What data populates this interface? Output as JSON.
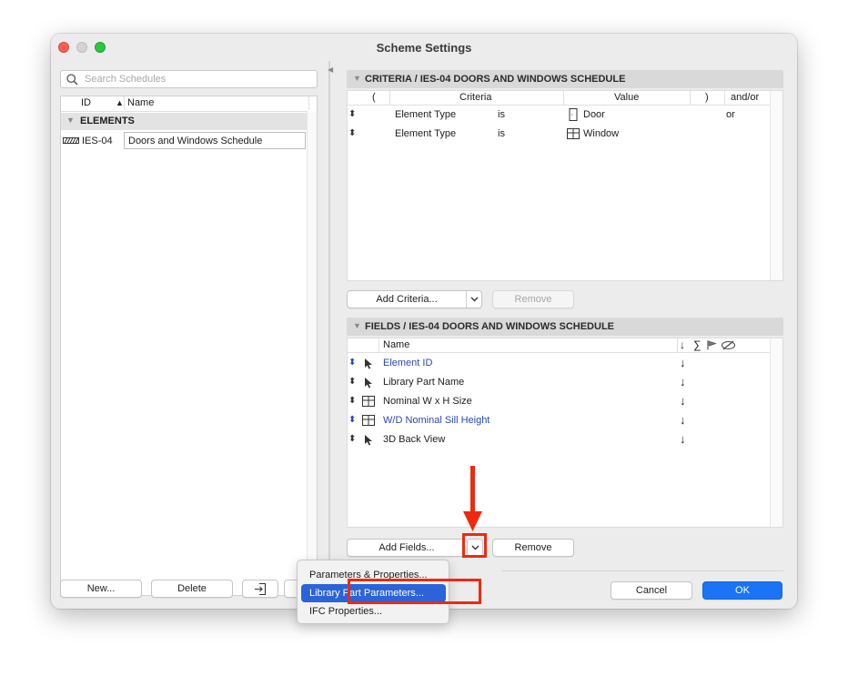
{
  "window": {
    "title": "Scheme Settings",
    "traffic_colors": [
      "#ff5f57",
      "#febc2e",
      "#28c840"
    ]
  },
  "left": {
    "search_placeholder": "Search Schedules",
    "columns": {
      "id": "ID",
      "name": "Name"
    },
    "group_label": "ELEMENTS",
    "schedule": {
      "id": "IES-04",
      "name": "Doors and Windows Schedule"
    },
    "buttons": {
      "new": "New...",
      "delete": "Delete"
    }
  },
  "criteria": {
    "header": "CRITERIA / IES-04 DOORS AND WINDOWS SCHEDULE",
    "columns": {
      "open": "(",
      "criteria": "Criteria",
      "value": "Value",
      "close": ")",
      "andor": "and/or"
    },
    "rows": [
      {
        "criteria": "Element Type",
        "op": "is",
        "value": "Door",
        "icon": "door-icon",
        "andor": "or"
      },
      {
        "criteria": "Element Type",
        "op": "is",
        "value": "Window",
        "icon": "window-icon",
        "andor": ""
      }
    ],
    "add_label": "Add Criteria...",
    "remove_label": "Remove"
  },
  "fields": {
    "header": "FIELDS / IES-04 DOORS AND WINDOWS SCHEDULE",
    "columns": {
      "name": "Name",
      "sort": "↓",
      "sum": "∑"
    },
    "rows": [
      {
        "name": "Element ID",
        "icon": "pointer-icon",
        "blue": true
      },
      {
        "name": "Library Part Name",
        "icon": "pointer-icon",
        "blue": false
      },
      {
        "name": "Nominal W x H Size",
        "icon": "window-icon",
        "blue": false
      },
      {
        "name": "W/D Nominal Sill Height",
        "icon": "window-icon",
        "blue": true
      },
      {
        "name": "3D Back View",
        "icon": "pointer-icon",
        "blue": false
      }
    ],
    "sort_glyph": "↓",
    "add_label": "Add Fields...",
    "remove_label": "Remove"
  },
  "menu": {
    "items": [
      "Parameters & Properties...",
      "Library Part Parameters...",
      "IFC Properties..."
    ],
    "selected_index": 1
  },
  "footer": {
    "cancel": "Cancel",
    "ok": "OK"
  },
  "colors": {
    "accent": "#1a74f5",
    "highlight": "#ee2a0f",
    "link": "#2a46b8"
  }
}
